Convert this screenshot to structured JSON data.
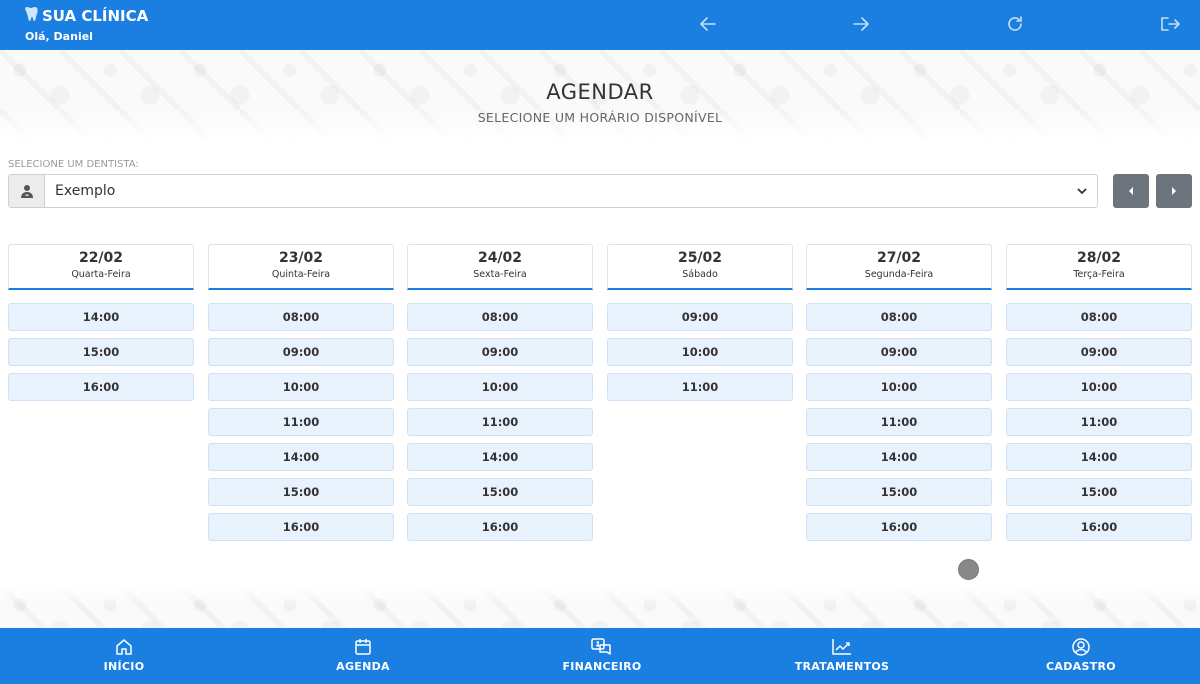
{
  "header": {
    "title": "SUA CLÍNICA",
    "greeting": "Olá, Daniel",
    "icons": [
      "arrow-left-icon",
      "arrow-right-icon",
      "refresh-icon",
      "logout-icon"
    ],
    "color": "#1a7fe0"
  },
  "page": {
    "title": "AGENDAR",
    "subtitle": "SELECIONE UM HORÁRIO DISPONÍVEL"
  },
  "dentist": {
    "label": "SELECIONE UM DENTISTA:",
    "value": "Exemplo",
    "icon": "user-doctor-icon"
  },
  "days": [
    {
      "date": "22/02",
      "weekday": "Quarta-Feira",
      "slots": [
        "14:00",
        "15:00",
        "16:00"
      ]
    },
    {
      "date": "23/02",
      "weekday": "Quinta-Feira",
      "slots": [
        "08:00",
        "09:00",
        "10:00",
        "11:00",
        "14:00",
        "15:00",
        "16:00"
      ]
    },
    {
      "date": "24/02",
      "weekday": "Sexta-Feira",
      "slots": [
        "08:00",
        "09:00",
        "10:00",
        "11:00",
        "14:00",
        "15:00",
        "16:00"
      ]
    },
    {
      "date": "25/02",
      "weekday": "Sábado",
      "slots": [
        "09:00",
        "10:00",
        "11:00"
      ]
    },
    {
      "date": "27/02",
      "weekday": "Segunda-Feira",
      "slots": [
        "08:00",
        "09:00",
        "10:00",
        "11:00",
        "14:00",
        "15:00",
        "16:00"
      ]
    },
    {
      "date": "28/02",
      "weekday": "Terça-Feira",
      "slots": [
        "08:00",
        "09:00",
        "10:00",
        "11:00",
        "14:00",
        "15:00",
        "16:00"
      ]
    }
  ],
  "bottom_nav": [
    {
      "label": "INÍCIO",
      "icon": "home-icon"
    },
    {
      "label": "AGENDA",
      "icon": "calendar-icon"
    },
    {
      "label": "FINANCEIRO",
      "icon": "money-chat-icon"
    },
    {
      "label": "TRATAMENTOS",
      "icon": "chart-line-icon"
    },
    {
      "label": "CADASTRO",
      "icon": "user-circle-icon"
    }
  ]
}
